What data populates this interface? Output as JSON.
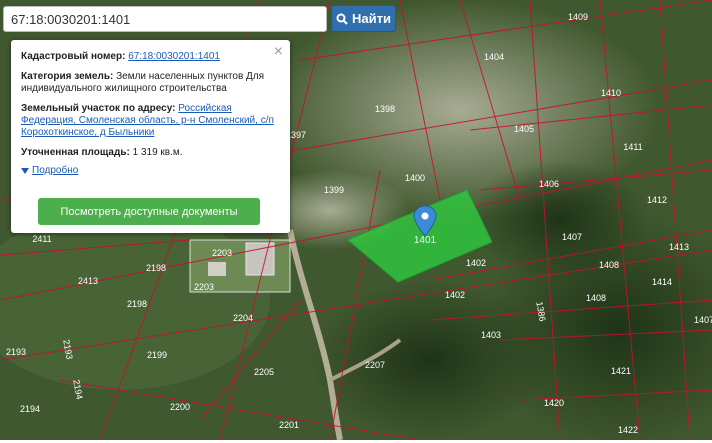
{
  "search": {
    "value": "67:18:0030201:1401",
    "button_label": "Найти"
  },
  "popup": {
    "cadastral_label": "Кадастровый номер:",
    "cadastral_value": "67:18:0030201:1401",
    "category_label": "Категория земель:",
    "category_value": "Земли населенных пунктов Для индивидуального жилищного строительства",
    "address_label": "Земельный участок по адресу:",
    "address_value": "Российская Федерация, Смоленская область, р-н Смоленский, с/п Корохоткинское, д Быльники",
    "area_label": "Уточненная площадь:",
    "area_value": "1 319 кв.м.",
    "more_label": "Подробно",
    "docs_button": "Посмотреть доступные документы",
    "close_symbol": "×"
  },
  "map": {
    "parcel_labels": [
      "1409",
      "1404",
      "1410",
      "1398",
      "1397",
      "1405",
      "1411",
      "1399",
      "1400",
      "1406",
      "1412",
      "1407",
      "1413",
      "1401",
      "1402",
      "2203",
      "2411",
      "2198",
      "2203",
      "1408",
      "1414",
      "2413",
      "2198",
      "1402",
      "1386",
      "1408",
      "2204",
      "1403",
      "1407",
      "2193",
      "2193",
      "2199",
      "2207",
      "2194",
      "2205",
      "1421",
      "2194",
      "2200",
      "1420",
      "2201",
      "1422"
    ],
    "selected_parcel_label": "1401",
    "colors": {
      "parcel_border": "#c8102e",
      "selected_fill": "#2ecc40",
      "marker": "#3b8bd8"
    }
  }
}
